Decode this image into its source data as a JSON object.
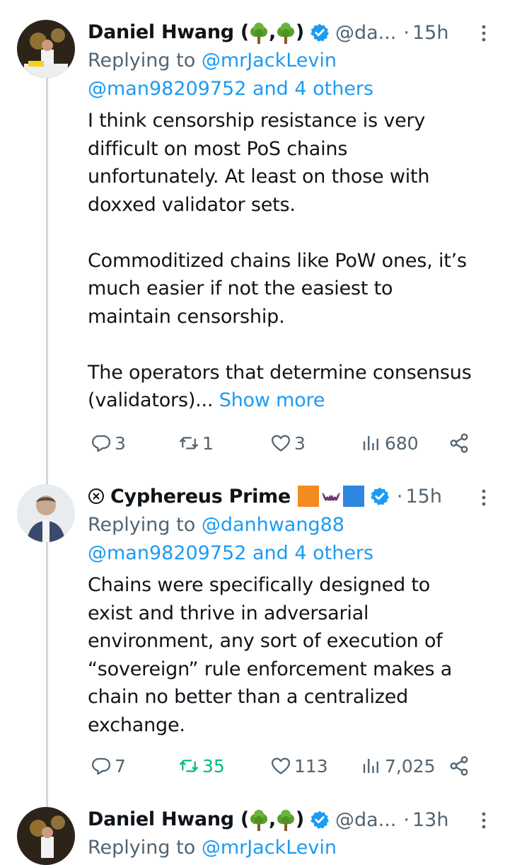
{
  "tweets": [
    {
      "name_first": "Daniel Hwang (",
      "name_sep": ",",
      "name_close": ")",
      "handle": "@da...",
      "dot": "·",
      "time": "15h",
      "replying_prefix": "Replying to ",
      "replying_link1": "@mrJackLevin",
      "replying_link2": "@man98209752 and 4 others",
      "body": "I think censorship resistance is very\ndifficult on most PoS chains\nunfortunately. At least on those with\ndoxxed validator sets.\n\nCommoditized chains like PoW ones, it’s\nmuch easier if not the easiest to\nmaintain censorship.\n\nThe operators that determine consensus\n(validators)...",
      "show_more": " Show more",
      "replies": "3",
      "reposts": "1",
      "likes": "3",
      "views": "680"
    },
    {
      "name": "Cyphereus Prime",
      "dot": "·",
      "time": "15h",
      "replying_prefix": "Replying to ",
      "replying_link1": "@danhwang88",
      "replying_link2": "@man98209752 and 4 others",
      "body": "Chains were specifically designed to\nexist and thrive in adversarial\nenvironment, any sort of execution of\n“sovereign” rule enforcement makes a\nchain no better than a centralized\nexchange.",
      "replies": "7",
      "reposts": "35",
      "likes": "113",
      "views": "7,025"
    },
    {
      "name_first": "Daniel Hwang (",
      "name_sep": ",",
      "name_close": ")",
      "handle": "@da...",
      "dot": "·",
      "time": "13h",
      "replying_prefix": "Replying to ",
      "replying_link1": "@mrJackLevin"
    }
  ],
  "colors": {
    "text": "#0f1419",
    "secondary": "#536471",
    "link": "#1d9bf0",
    "repost_active": "#00ba7c",
    "verified": "#1d9bf0",
    "thread_line": "#cfd9de"
  },
  "icons": {
    "reply": "speech-bubble-icon",
    "repost": "repost-arrows-icon",
    "like": "heart-icon",
    "views": "bar-chart-icon",
    "share": "share-nodes-icon",
    "verified": "verified-badge-icon",
    "more": "vertical-dots-icon",
    "tree": "deciduous-tree-emoji",
    "x": "circled-x-icon",
    "orange_square": "orange-square-emoji",
    "bat": "bat-emoji",
    "blue_square": "blue-square-emoji"
  }
}
